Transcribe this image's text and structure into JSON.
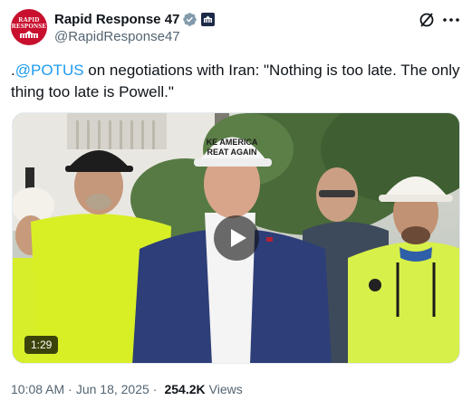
{
  "author": {
    "display_name": "Rapid Response 47",
    "handle": "@RapidResponse47",
    "avatar_text": [
      "RAPID",
      "RESPONSE"
    ],
    "avatar_icon": "white-house-logo",
    "verified_icon": "verified-badge-icon",
    "affiliation_icon": "government-affiliation-icon",
    "colors": {
      "avatar_bg": "#c8102e",
      "verified": "#829aab"
    }
  },
  "header_actions": {
    "grok_icon": "grok-icon",
    "more_icon": "more-options-icon"
  },
  "tweet": {
    "text_prefix": ".",
    "mention": "@POTUS",
    "text_body": " on negotiations with Iran: \"Nothing is too late. The only thing too late is Powell.\"",
    "mention_color": "#1d9bf0"
  },
  "video": {
    "duration": "1:29",
    "play_icon": "play-icon",
    "hat_text": [
      "KE AMERICA",
      "REAT AGAIN"
    ]
  },
  "meta": {
    "time": "10:08 AM",
    "separator": "·",
    "date": "Jun 18, 2025",
    "views_count": "254.2K",
    "views_label": "Views"
  }
}
